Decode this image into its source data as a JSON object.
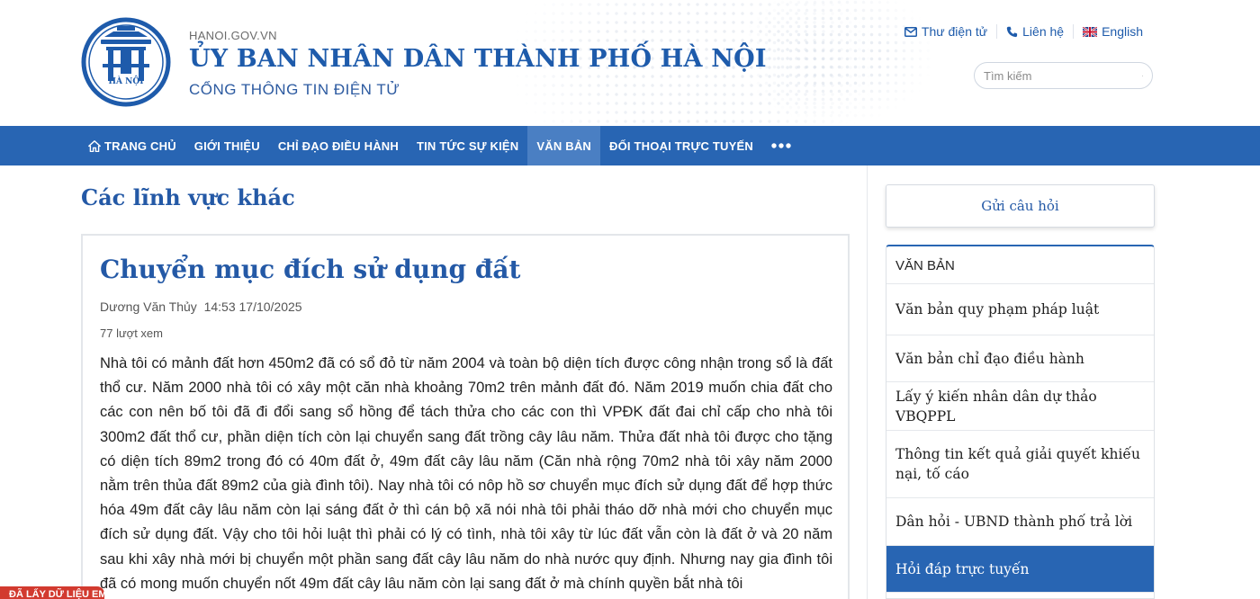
{
  "header": {
    "domain": "HANOI.GOV.VN",
    "title": "ỦY BAN NHÂN DÂN THÀNH PHỐ HÀ NỘI",
    "subtitle": "CỔNG THÔNG TIN ĐIỆN TỬ",
    "logo_text": "HÀ NỘI",
    "brand_color": "#1e5bab"
  },
  "top_links": [
    {
      "label": "Thư điện tử",
      "icon": "envelope-icon"
    },
    {
      "label": "Liên hệ",
      "icon": "phone-icon"
    },
    {
      "label": "English",
      "icon": "uk-flag-icon"
    }
  ],
  "search": {
    "placeholder": "Tìm kiếm",
    "icon": "search-icon"
  },
  "nav": {
    "color": "#2865b3",
    "items": [
      {
        "label": "TRANG CHỦ",
        "icon": "home-icon"
      },
      {
        "label": "GIỚI THIỆU"
      },
      {
        "label": "CHỈ ĐẠO ĐIỀU HÀNH"
      },
      {
        "label": "TIN TỨC SỰ KIỆN"
      },
      {
        "label": "VĂN BẢN",
        "active": true
      },
      {
        "label": "ĐỐI THOẠI TRỰC TUYẾN"
      }
    ],
    "more_icon": "more-dots-icon"
  },
  "section_title": "Các lĩnh vực khác",
  "article": {
    "title": "Chuyển mục đích sử dụng đất",
    "author": "Dương Văn Thủy",
    "datetime": "14:53 17/10/2025",
    "views": "77 lượt xem",
    "body": "Nhà tôi có mảnh đất hơn 450m2 đã có sổ đỏ từ năm 2004 và toàn bộ diện tích được công nhận trong sổ là đất thổ cư. Năm 2000 nhà tôi có xây một căn nhà khoảng 70m2 trên mảnh đất đó. Năm 2019 muốn chia đất cho các con nên bố tôi đã đi đổi sang sổ hồng để tách thửa cho các con thì VPĐK đất đai chỉ cấp cho nhà tôi 300m2 đất thổ cư, phần diện tích còn lại chuyển sang đất trồng cây lâu năm. Thửa đất nhà tôi được cho tặng có diện tích 89m2 trong đó có 40m đất ở, 49m đất cây lâu năm (Căn nhà rộng 70m2 nhà tôi xây năm 2000 nằm trên thủa đất 89m2 của già đình tôi). Nay nhà tôi có nôp hồ sơ chuyển mục đích sử dụng đất để hợp thức hóa 49m đất cây lâu năm còn lại sáng đất ở thì cán bộ xã nói nhà tôi phải tháo dỡ nhà mới cho chuyển mục đích sử dụng đất. Vậy cho tôi hỏi luật thì phải có lý có tình, nhà tôi xây từ lúc đất vẫn còn là đất ở và 20 năm sau khi xây nhà mới bị chuyển một phần sang đất cây lâu năm do nhà nước quy định. Nhưng nay gia đình tôi đã có mong muốn chuyển nốt 49m đất cây lâu năm còn lại sang đất ở mà chính quyền bắt nhà tôi"
  },
  "sidebar": {
    "ask_button": "Gửi câu hỏi",
    "heading": "VĂN BẢN",
    "items": [
      {
        "label": "Văn bản quy phạm pháp luật"
      },
      {
        "label": "Văn bản chỉ đạo điều hành"
      },
      {
        "label": "Lấy ý kiến nhân dân dự thảo VBQPPL"
      },
      {
        "label": "Thông tin kết quả giải quyết khiếu nại, tố cáo"
      },
      {
        "label": "Dân hỏi - UBND thành phố trả lời"
      },
      {
        "label": "Hỏi đáp trực tuyến",
        "active": true
      }
    ]
  },
  "badge": {
    "label": "ĐÃ LẤY DỮ LIỆU EMO",
    "color": "#d23a2f"
  }
}
